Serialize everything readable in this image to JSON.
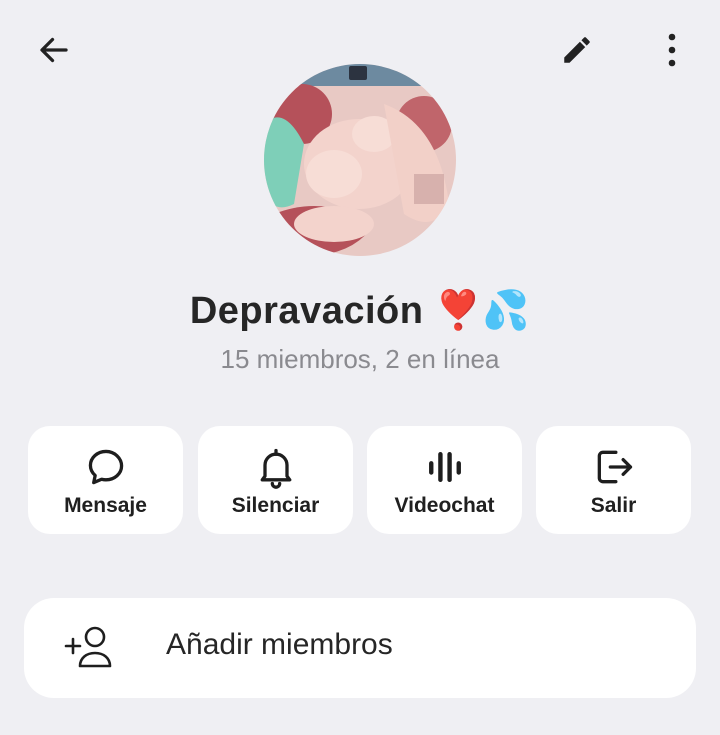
{
  "header": {
    "back_icon": "arrow-left-icon",
    "edit_icon": "pencil-icon",
    "more_icon": "more-vertical-icon"
  },
  "group": {
    "name": "Depravación",
    "name_emoji": "❣️💦",
    "status": "15 miembros, 2 en línea",
    "avatar_icon": "group-avatar-image"
  },
  "actions": [
    {
      "label": "Mensaje",
      "icon": "message-bubble-icon"
    },
    {
      "label": "Silenciar",
      "icon": "bell-icon"
    },
    {
      "label": "Videochat",
      "icon": "audio-bars-icon"
    },
    {
      "label": "Salir",
      "icon": "logout-icon"
    }
  ],
  "add_members": {
    "label": "Añadir miembros",
    "icon": "add-user-icon"
  },
  "colors": {
    "background": "#efeff3",
    "card": "#ffffff",
    "text_primary": "#262626",
    "text_secondary": "#8a8a8f"
  }
}
